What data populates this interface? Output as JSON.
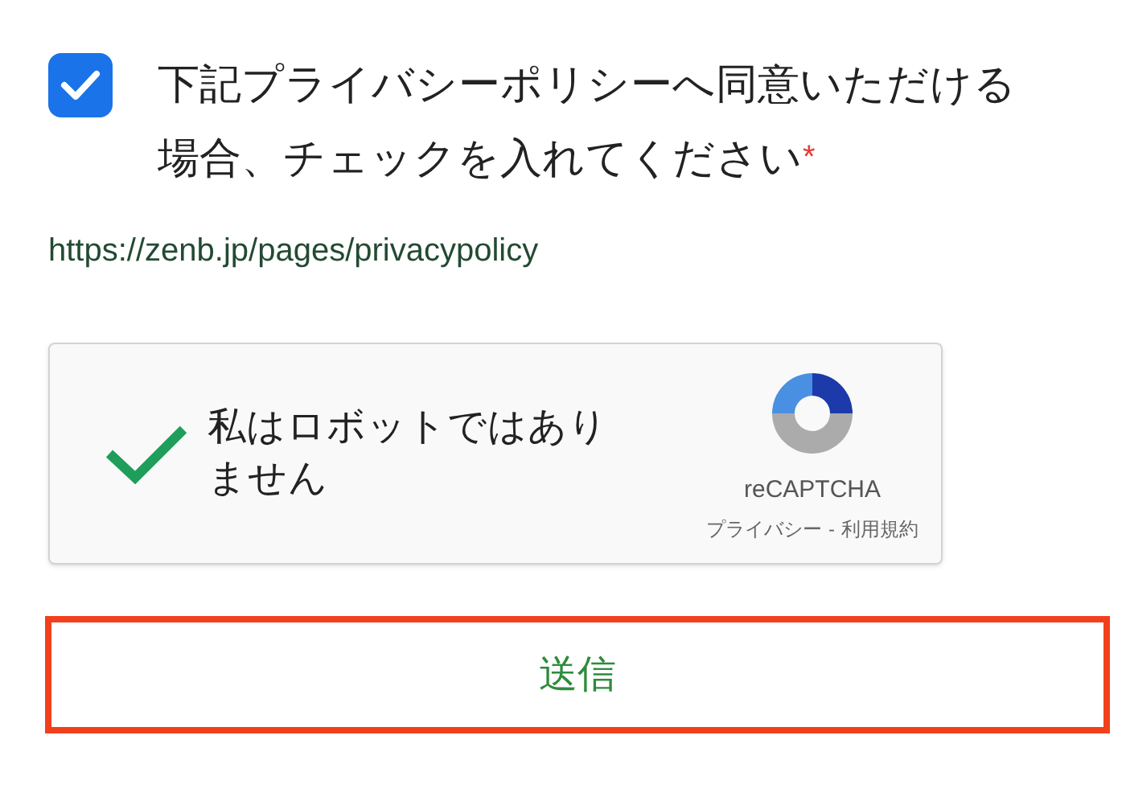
{
  "consent": {
    "checked": true,
    "label": "下記プライバシーポリシーへ同意いただける場合、チェックを入れてください",
    "required_mark": "*"
  },
  "policy_link": "https://zenb.jp/pages/privacypolicy",
  "recaptcha": {
    "verified": true,
    "label": "私はロボットではありません",
    "brand": "reCAPTCHA",
    "privacy": "プライバシー",
    "separator": "-",
    "terms": "利用規約"
  },
  "submit": {
    "label": "送信"
  }
}
